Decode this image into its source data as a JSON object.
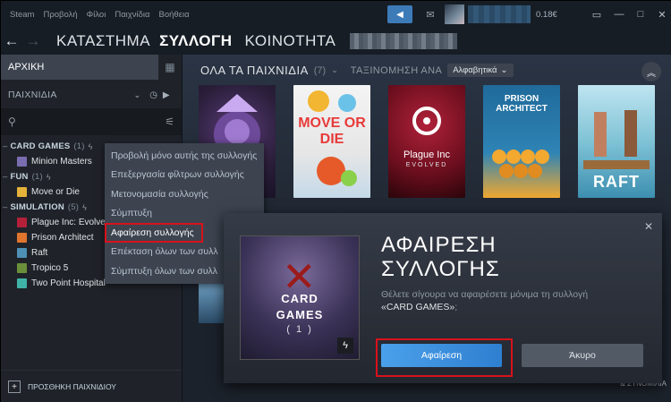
{
  "menu": [
    "Steam",
    "Προβολή",
    "Φίλοι",
    "Παιχνίδια",
    "Βοήθεια"
  ],
  "topbar": {
    "balance": "0.18€"
  },
  "nav": {
    "store": "ΚΑΤΑΣΤΗΜΑ",
    "library": "ΣΥΛΛΟΓΗ",
    "community": "ΚΟΙΝΟΤΗΤΑ"
  },
  "sidebar": {
    "home": "ΑΡΧΙΚΗ",
    "games_dropdown": "ΠΑΙΧΝΙΔΙΑ",
    "collections": [
      {
        "name": "CARD GAMES",
        "count": "(1)",
        "games": [
          "Minion Masters"
        ]
      },
      {
        "name": "FUN",
        "count": "(1)",
        "games": [
          "Move or Die"
        ]
      },
      {
        "name": "SIMULATION",
        "count": "(5)",
        "games": [
          "Plague Inc: Evolved",
          "Prison Architect",
          "Raft",
          "Tropico 5",
          "Two Point Hospital"
        ]
      }
    ],
    "add_game": "ΠΡΟΣΘΗΚΗ ΠΑΙΧΝΙΔΙΟΥ"
  },
  "shelf": {
    "title": "ΟΛΑ ΤΑ ΠΑΙΧΝΙΔΙΑ",
    "count": "(7)",
    "sort_label": "ΤΑΞΙΝΟΜΗΣΗ ΑΝΑ",
    "sort_value": "Αλφαβητικά",
    "covers": [
      {
        "title": ""
      },
      {
        "title": "MOVE OR DIE"
      },
      {
        "title": "Plague Inc",
        "subtitle": "EVOLVED"
      },
      {
        "title": "PRISON ARCHITECT"
      },
      {
        "title": "RAFT"
      }
    ]
  },
  "context_menu": [
    "Προβολή μόνο αυτής της συλλογής",
    "Επεξεργασία φίλτρων συλλογής",
    "Μετονομασία συλλογής",
    "Σύμπτυξη",
    "Αφαίρεση συλλογής",
    "Επέκταση όλων των συλλ",
    "Σύμπτυξη όλων των συλλ"
  ],
  "dialog": {
    "title_line1": "ΑΦΑΙΡΕΣΗ",
    "title_line2": "ΣΥΛΛΟΓΗΣ",
    "body_prefix": "Θέλετε σίγουρα να αφαιρέσετε μόνιμα τη συλλογή",
    "body_name": "«CARD GAMES»",
    "body_suffix": ";",
    "art_line1": "CARD",
    "art_line2": "GAMES",
    "art_line3": "( 1 )",
    "remove_button": "Αφαίρεση",
    "cancel_button": "Άκυρο"
  },
  "footer": {
    "friends": "& ΣΥΝΟΜΙΛΙΑ"
  },
  "colors": {
    "accent": "#3d7bb8",
    "highlight": "#d8121b",
    "primary_button": "#3a8fe0"
  }
}
